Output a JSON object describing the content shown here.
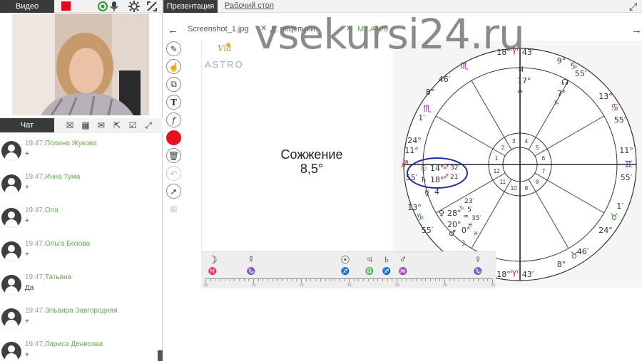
{
  "video": {
    "tab_label": "Видео"
  },
  "chat": {
    "tab_label": "Чат",
    "messages": [
      {
        "time": "19:47,",
        "name": "Полина Жукова",
        "text": "+"
      },
      {
        "time": "19:47,",
        "name": "Инна Тума",
        "text": "+"
      },
      {
        "time": "19:47,",
        "name": "Оля",
        "text": "+"
      },
      {
        "time": "19:47,",
        "name": "Ольга Бозова",
        "text": "+"
      },
      {
        "time": "19:47,",
        "name": "Татьяна",
        "text": "Да"
      },
      {
        "time": "19:47,",
        "name": "Эльвира Завгородняя",
        "text": "+"
      },
      {
        "time": "19:47,",
        "name": "Лариса Денисова",
        "text": "+"
      }
    ]
  },
  "top": {
    "presentation_tab": "Презентация",
    "desktop_tab": "Рабочий стол"
  },
  "files": {
    "tab1": "Screenshot_1.jpg",
    "tab2": "Д. рецепции",
    "tab3": "Ms.Astro"
  },
  "slide": {
    "logo_via": "Via",
    "logo_astro": "ASTRO",
    "heading_line1": "Сожжение",
    "heading_line2": "8,5°"
  },
  "chart": {
    "house_numbers": [
      "1",
      "2",
      "3",
      "4",
      "5",
      "6",
      "7",
      "8",
      "9",
      "10",
      "11",
      "12"
    ],
    "cusp_degrees": [
      {
        "deg": "18°",
        "min": "43′"
      },
      {
        "deg": "9°",
        "min": "55′"
      },
      {
        "deg": "13°",
        "min": "55′"
      },
      {
        "deg": "11°",
        "min": "55′"
      },
      {
        "deg": "1′",
        "min": "24°"
      },
      {
        "deg": "8°",
        "min": "46′"
      },
      {
        "deg": "18°",
        "min": "43′"
      },
      {
        "deg": "8°",
        "min": "46′"
      },
      {
        "deg": "13°",
        "min": "55′"
      },
      {
        "deg": "11°",
        "min": "55′"
      },
      {
        "deg": "1′",
        "min": "24°"
      },
      {
        "deg": "8°",
        "min": "46′"
      }
    ],
    "planet_labels": [
      "14°",
      "18°",
      "32′",
      "21′",
      "4",
      "28°",
      "20°",
      "0°",
      "17°",
      "7°",
      "23′",
      "5′",
      "35′"
    ]
  },
  "ephemeris": {
    "symbols": [
      {
        "glyph": "☽",
        "sign": "♓",
        "color": "#8a2a9a"
      },
      {
        "glyph": "☿",
        "sign": "♑",
        "color": "#2a8a2a"
      },
      {
        "glyph": "☉",
        "sign": "♐",
        "color": "#d02020"
      },
      {
        "glyph": "♃",
        "sign": "♎",
        "color": "#2040c0"
      },
      {
        "glyph": "♄",
        "sign": "♐",
        "color": "#d02020"
      },
      {
        "glyph": "♂",
        "sign": "♒",
        "color": "#2040c0"
      },
      {
        "glyph": "♀",
        "sign": "♑",
        "color": "#2a8a2a"
      }
    ],
    "scale_labels": [
      "00",
      "05",
      "10",
      "15",
      "20",
      "25",
      "30"
    ]
  },
  "watermark": "vsekursi24.ru",
  "colors": {
    "dark_tab": "#3a3a3a",
    "record": "#e8001c",
    "name_green": "#6aa84f",
    "circle_blue": "#1c2fa8"
  }
}
